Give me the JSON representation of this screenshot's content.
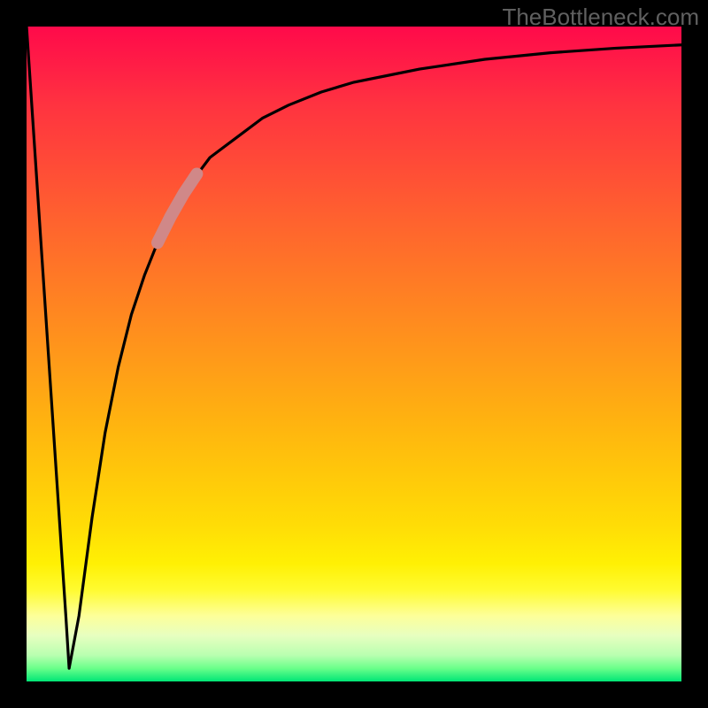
{
  "watermark": "TheBottleneck.com",
  "chart_data": {
    "type": "line",
    "title": "",
    "xlabel": "",
    "ylabel": "",
    "xlim": [
      0,
      100
    ],
    "ylim": [
      0,
      100
    ],
    "grid": false,
    "gradient_stops": [
      {
        "pos": 0.0,
        "color": "#ff0a4a"
      },
      {
        "pos": 0.2,
        "color": "#ff4838"
      },
      {
        "pos": 0.4,
        "color": "#ff8020"
      },
      {
        "pos": 0.6,
        "color": "#ffb210"
      },
      {
        "pos": 0.8,
        "color": "#ffe806"
      },
      {
        "pos": 0.92,
        "color": "#f5ffb0"
      },
      {
        "pos": 1.0,
        "color": "#00e676"
      }
    ],
    "series": [
      {
        "name": "bottleneck-curve",
        "x": [
          0,
          2,
          4,
          6,
          6.5,
          8,
          10,
          12,
          14,
          16,
          18,
          20,
          22,
          25,
          28,
          32,
          36,
          40,
          45,
          50,
          55,
          60,
          70,
          80,
          90,
          100
        ],
        "y": [
          100,
          70,
          40,
          10,
          2,
          10,
          25,
          38,
          48,
          56,
          62,
          67,
          71,
          76,
          80,
          83,
          86,
          88,
          90,
          91.5,
          92.5,
          93.5,
          95,
          96,
          96.7,
          97.2
        ]
      }
    ],
    "highlight": {
      "name": "highlight-segment",
      "color": "#d08888",
      "x": [
        20,
        22,
        24,
        26
      ],
      "y": [
        67,
        71,
        74.5,
        77.5
      ]
    }
  }
}
